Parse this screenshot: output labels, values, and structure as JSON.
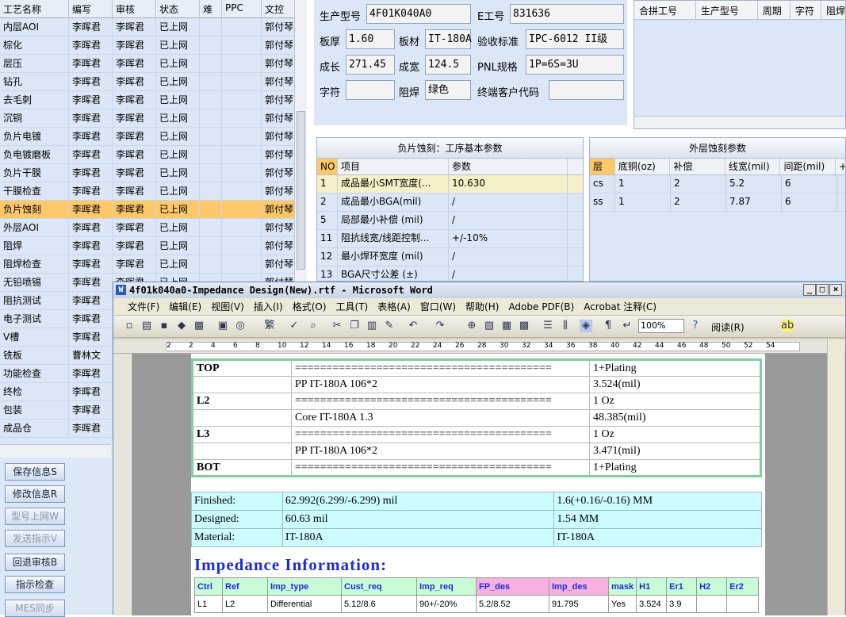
{
  "left_list": {
    "headers": [
      "工艺名称",
      "编写",
      "审核",
      "状态",
      "难",
      "PPC",
      "文控"
    ],
    "rows": [
      [
        "内层AOI",
        "李晖君",
        "李晖君",
        "已上网",
        "",
        "",
        "郭付琴"
      ],
      [
        "棕化",
        "李晖君",
        "李晖君",
        "已上网",
        "",
        "",
        "郭付琴"
      ],
      [
        "层压",
        "李晖君",
        "李晖君",
        "已上网",
        "",
        "",
        "郭付琴"
      ],
      [
        "钻孔",
        "李晖君",
        "李晖君",
        "已上网",
        "",
        "",
        "郭付琴"
      ],
      [
        "去毛刺",
        "李晖君",
        "李晖君",
        "已上网",
        "",
        "",
        "郭付琴"
      ],
      [
        "沉铜",
        "李晖君",
        "李晖君",
        "已上网",
        "",
        "",
        "郭付琴"
      ],
      [
        "负片电镀",
        "李晖君",
        "李晖君",
        "已上网",
        "",
        "",
        "郭付琴"
      ],
      [
        "负电镀磨板",
        "李晖君",
        "李晖君",
        "已上网",
        "",
        "",
        "郭付琴"
      ],
      [
        "负片干膜",
        "李晖君",
        "李晖君",
        "已上网",
        "",
        "",
        "郭付琴"
      ],
      [
        "干膜检查",
        "李晖君",
        "李晖君",
        "已上网",
        "",
        "",
        "郭付琴"
      ],
      [
        "负片蚀刻",
        "李晖君",
        "李晖君",
        "已上网",
        "",
        "",
        "郭付琴"
      ],
      [
        "外层AOI",
        "李晖君",
        "李晖君",
        "已上网",
        "",
        "",
        "郭付琴"
      ],
      [
        "阻焊",
        "李晖君",
        "李晖君",
        "已上网",
        "",
        "",
        "郭付琴"
      ],
      [
        "阻焊检查",
        "李晖君",
        "李晖君",
        "已上网",
        "",
        "",
        "郭付琴"
      ],
      [
        "无铅喷锡",
        "李晖君",
        "李晖君",
        "已上网",
        "",
        "",
        "郭付琴"
      ],
      [
        "阻抗测试",
        "李晖君",
        "",
        "",
        "",
        "",
        ""
      ],
      [
        "电子测试",
        "李晖君",
        "",
        "",
        "",
        "",
        ""
      ],
      [
        "V槽",
        "李晖君",
        "",
        "",
        "",
        "",
        ""
      ],
      [
        "铣板",
        "曹林文",
        "",
        "",
        "",
        "",
        ""
      ],
      [
        "功能检查",
        "李晖君",
        "",
        "",
        "",
        "",
        ""
      ],
      [
        "终检",
        "李晖君",
        "",
        "",
        "",
        "",
        ""
      ],
      [
        "包装",
        "李晖君",
        "",
        "",
        "",
        "",
        ""
      ],
      [
        "成品仓",
        "李晖君",
        "",
        "",
        "",
        "",
        ""
      ]
    ]
  },
  "buttons": [
    "保存信息S",
    "修改信息R",
    "型号上网W",
    "发送指示V",
    "回退审核B",
    "指示检查",
    "MES同步"
  ],
  "form": {
    "prod_label": "生产型号",
    "prod_value": "4F01K040A0",
    "e_label": "E工号",
    "e_value": "831636",
    "thick_label": "板厚",
    "thick_value": "1.60",
    "mat_label": "板材",
    "mat_value": "IT-180A",
    "accept_label": "验收标准",
    "accept_value": "IPC-6012 II级",
    "len_label": "成长",
    "len_value": "271.45",
    "wid_label": "成宽",
    "wid_value": "124.5",
    "pnl_label": "PNL规格",
    "pnl_value": "1P=6S=3U",
    "char_label": "字符",
    "char_value": "",
    "mask_label": "阻焊",
    "mask_value": "绿色",
    "cust_label": "终端客户代码",
    "cust_value": ""
  },
  "merge_table": {
    "headers": [
      "合拼工号",
      "生产型号",
      "周期",
      "字符",
      "阻焊"
    ]
  },
  "etch_panel": {
    "title": "负片蚀刻：工序基本参数",
    "headers": [
      "NO",
      "项目",
      "参数"
    ],
    "rows": [
      [
        "1",
        "成品最小SMT宽度(...",
        "10.630"
      ],
      [
        "2",
        "成品最小BGA(mil)",
        "/"
      ],
      [
        "5",
        "局部最小补偿 (mil)",
        "/"
      ],
      [
        "11",
        "阻抗线宽/线距控制...",
        "+/-10%"
      ],
      [
        "12",
        "最小焊环宽度 (mil)",
        "/"
      ],
      [
        "13",
        "BGA尺寸公差 (±)",
        "/"
      ]
    ]
  },
  "outer_panel": {
    "title": "外层蚀刻参数",
    "headers": [
      "层",
      "底铜(oz)",
      "补偿",
      "线宽(mil)",
      "间距(mil)",
      "+"
    ],
    "rows": [
      [
        "cs",
        "1",
        "2",
        "5.2",
        "6"
      ],
      [
        "ss",
        "1",
        "2",
        "7.87",
        "6"
      ]
    ]
  },
  "word": {
    "title": "4f01k040a0-Impedance Design(New).rtf - Microsoft Word",
    "menu": [
      "文件(F)",
      "编辑(E)",
      "视图(V)",
      "插入(I)",
      "格式(O)",
      "工具(T)",
      "表格(A)",
      "窗口(W)",
      "帮助(H)",
      "Adobe PDF(B)",
      "Acrobat 注释(C)"
    ],
    "zoom": "100%",
    "read_label": "阅读(R)",
    "ruler_ticks": [
      "2",
      "2",
      "4",
      "6",
      "8",
      "10",
      "12",
      "14",
      "16",
      "18",
      "20",
      "22",
      "24",
      "26",
      "28",
      "30",
      "32",
      "34",
      "36",
      "38",
      "40",
      "42",
      "44",
      "46",
      "48",
      "50",
      "52",
      "54"
    ],
    "stack": [
      [
        "TOP",
        "",
        "=========================================",
        "1+Plating"
      ],
      [
        "",
        "PP      IT-180A     106*2",
        "",
        "3.524(mil)"
      ],
      [
        "L2",
        "",
        "=========================================",
        "1 Oz"
      ],
      [
        "",
        "Core      IT-180A     1.3",
        "",
        "48.385(mil)"
      ],
      [
        "L3",
        "",
        "=========================================",
        "1 Oz"
      ],
      [
        "",
        "PP      IT-180A     106*2",
        "",
        "3.471(mil)"
      ],
      [
        "BOT",
        "",
        "=========================================",
        "1+Plating"
      ]
    ],
    "imp_summary": [
      [
        "Finished:",
        "62.992(6.299/-6.299) mil",
        "1.6(+0.16/-0.16) MM"
      ],
      [
        "Designed:",
        "60.63 mil",
        "1.54 MM"
      ],
      [
        "Material:",
        "IT-180A",
        "IT-180A"
      ]
    ],
    "imp_title": "Impedance Information:",
    "detail_headers": [
      "Ctrl",
      "Ref",
      "Imp_type",
      "Cust_req",
      "Imp_req",
      "FP_des",
      "Imp_des",
      "mask",
      "H1",
      "Er1",
      "H2",
      "Er2"
    ],
    "detail_row": [
      "L1",
      "L2",
      "Differential",
      "5.12/8.6",
      "90+/-20%",
      "5.2/8.52",
      "91.795",
      "Yes",
      "3.524",
      "3.9",
      "",
      ""
    ]
  }
}
